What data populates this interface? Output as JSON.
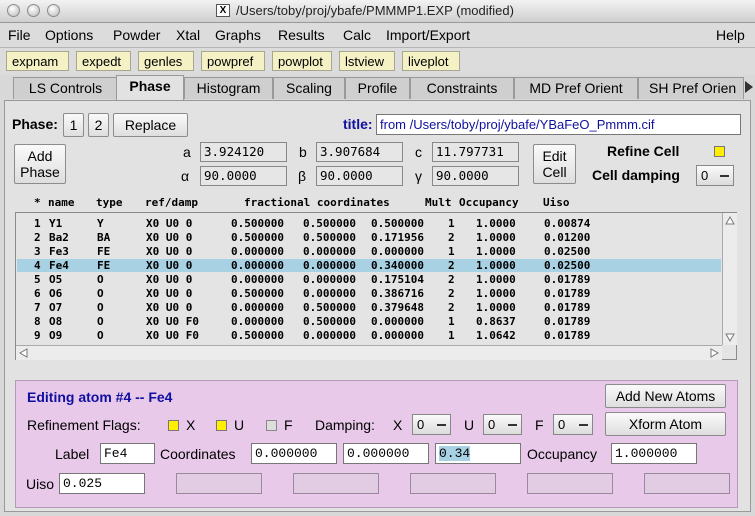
{
  "window": {
    "title": "/Users/toby/proj/ybafe/PMMMP1.EXP (modified)",
    "x11_badge": "X"
  },
  "menu": [
    "File",
    "Options",
    "Powder",
    "Xtal",
    "Graphs",
    "Results",
    "Calc",
    "Import/Export",
    "Help"
  ],
  "toolbar": [
    "expnam",
    "expedt",
    "genles",
    "powpref",
    "powplot",
    "lstview",
    "liveplot"
  ],
  "tabs": [
    "LS Controls",
    "Phase",
    "Histogram",
    "Scaling",
    "Profile",
    "Constraints",
    "MD Pref Orient",
    "SH Pref Orien"
  ],
  "selected_tab": "Phase",
  "phase": {
    "label": "Phase:",
    "buttons": [
      "1",
      "2"
    ],
    "replace": "Replace",
    "title_label": "title:",
    "title_value": "from /Users/toby/proj/ybafe/YBaFeO_Pmmm.cif",
    "add_phase": [
      "Add",
      "Phase"
    ],
    "edit_cell": [
      "Edit",
      "Cell"
    ],
    "cell": {
      "a_label": "a",
      "a": "3.924120",
      "b_label": "b",
      "b": "3.907684",
      "c_label": "c",
      "c": "11.797731",
      "alpha_label": "α",
      "alpha": "90.0000",
      "beta_label": "β",
      "beta": "90.0000",
      "gamma_label": "γ",
      "gamma": "90.0000"
    },
    "refine_cell": "Refine Cell",
    "cell_damping_label": "Cell damping",
    "cell_damping_value": "0"
  },
  "atoms_table": {
    "headers": {
      "star": "*",
      "name": "name",
      "type": "type",
      "refdamp": "ref/damp",
      "coords": "fractional coordinates",
      "mult": "Mult",
      "occ": "Occupancy",
      "uiso": "Uiso"
    },
    "rows": [
      {
        "num": "1",
        "name": "Y1",
        "type": "Y",
        "ref": "X0 U0  0",
        "x": "0.500000",
        "y": "0.500000",
        "z": "0.500000",
        "mult": "1",
        "occ": "1.0000",
        "uiso": "0.00874"
      },
      {
        "num": "2",
        "name": "Ba2",
        "type": "BA",
        "ref": "X0 U0  0",
        "x": "0.500000",
        "y": "0.500000",
        "z": "0.171956",
        "mult": "2",
        "occ": "1.0000",
        "uiso": "0.01200"
      },
      {
        "num": "3",
        "name": "Fe3",
        "type": "FE",
        "ref": "X0 U0  0",
        "x": "0.000000",
        "y": "0.000000",
        "z": "0.000000",
        "mult": "1",
        "occ": "1.0000",
        "uiso": "0.02500"
      },
      {
        "num": "4",
        "name": "Fe4",
        "type": "FE",
        "ref": "X0 U0  0",
        "x": "0.000000",
        "y": "0.000000",
        "z": "0.340000",
        "mult": "2",
        "occ": "1.0000",
        "uiso": "0.02500"
      },
      {
        "num": "5",
        "name": "O5",
        "type": "O",
        "ref": "X0 U0  0",
        "x": "0.000000",
        "y": "0.000000",
        "z": "0.175104",
        "mult": "2",
        "occ": "1.0000",
        "uiso": "0.01789"
      },
      {
        "num": "6",
        "name": "O6",
        "type": "O",
        "ref": "X0 U0  0",
        "x": "0.500000",
        "y": "0.000000",
        "z": "0.386716",
        "mult": "2",
        "occ": "1.0000",
        "uiso": "0.01789"
      },
      {
        "num": "7",
        "name": "O7",
        "type": "O",
        "ref": "X0 U0  0",
        "x": "0.000000",
        "y": "0.500000",
        "z": "0.379648",
        "mult": "2",
        "occ": "1.0000",
        "uiso": "0.01789"
      },
      {
        "num": "8",
        "name": "O8",
        "type": "O",
        "ref": "X0 U0 F0",
        "x": "0.000000",
        "y": "0.500000",
        "z": "0.000000",
        "mult": "1",
        "occ": "0.8637",
        "uiso": "0.01789"
      },
      {
        "num": "9",
        "name": "O9",
        "type": "O",
        "ref": "X0 U0 F0",
        "x": "0.500000",
        "y": "0.000000",
        "z": "0.000000",
        "mult": "1",
        "occ": "1.0642",
        "uiso": "0.01789"
      }
    ],
    "selected_row": 3
  },
  "editor": {
    "heading": "Editing atom #4 -- Fe4",
    "add_new_atoms": "Add New Atoms",
    "xform_atom": "Xform Atom",
    "flags_label": "Refinement Flags:",
    "flag_x": "X",
    "flag_u": "U",
    "flag_f": "F",
    "damping_label": "Damping:",
    "damp_x_label": "X",
    "damp_x": "0",
    "damp_u_label": "U",
    "damp_u": "0",
    "damp_f_label": "F",
    "damp_f": "0",
    "label_label": "Label",
    "label_value": "Fe4",
    "coords_label": "Coordinates",
    "coord_x": "0.000000",
    "coord_y": "0.000000",
    "coord_z": "0.34",
    "occupancy_label": "Occupancy",
    "occupancy": "1.000000",
    "uiso_label": "Uiso",
    "uiso": "0.025"
  },
  "colors": {
    "toolbar_button": "#f4f1c4",
    "selected_row": "#a8d1e3",
    "editor_bg": "#e8c9ea",
    "checkbox_on": "#ffee00",
    "title_blue": "#1010a0"
  }
}
